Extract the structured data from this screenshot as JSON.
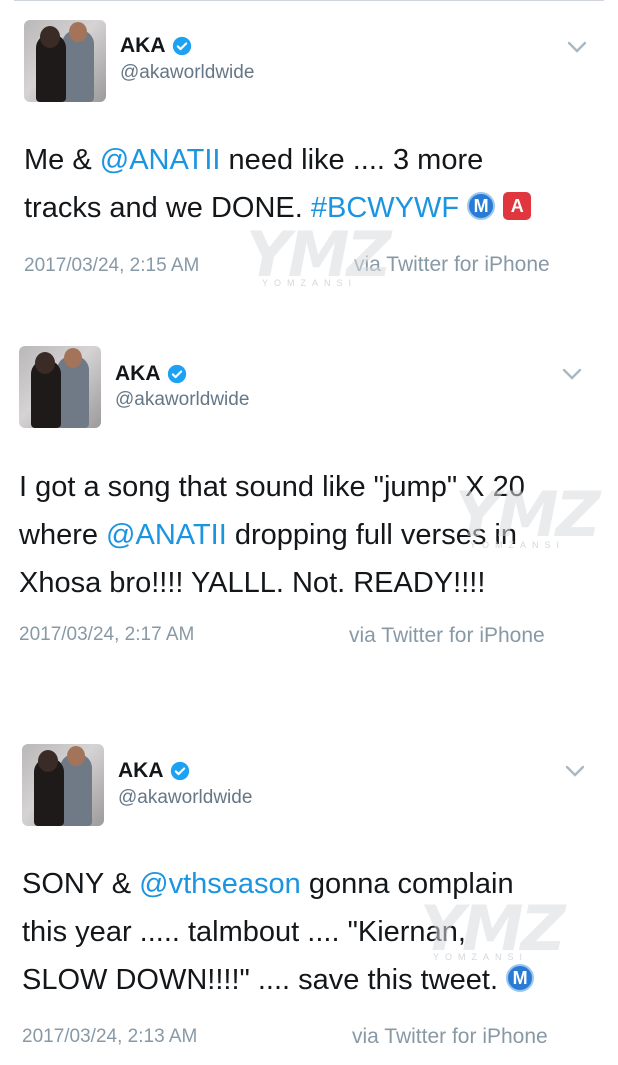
{
  "tweets": [
    {
      "name": "AKA",
      "handle": "@akaworldwide",
      "lines": [
        [
          {
            "t": "Me & "
          },
          {
            "t": "@ANATII",
            "link": true
          },
          {
            "t": " need like .... 3 more"
          }
        ],
        [
          {
            "t": "tracks and we DONE. "
          },
          {
            "t": "#BCWYWF",
            "link": true
          },
          {
            "t": " "
          },
          {
            "e": "M"
          },
          {
            "t": " "
          },
          {
            "e": "A"
          }
        ]
      ],
      "timestamp": "2017/03/24, 2:15 AM",
      "source": "via Twitter for iPhone"
    },
    {
      "name": "AKA",
      "handle": "@akaworldwide",
      "lines": [
        [
          {
            "t": "I got a song that sound like \"jump\" X 20"
          }
        ],
        [
          {
            "t": "where "
          },
          {
            "t": "@ANATII",
            "link": true
          },
          {
            "t": " dropping full verses in"
          }
        ],
        [
          {
            "t": "Xhosa bro!!!! YALLL. Not. READY!!!!"
          }
        ]
      ],
      "timestamp": "2017/03/24, 2:17 AM",
      "source": "via Twitter for iPhone"
    },
    {
      "name": "AKA",
      "handle": "@akaworldwide",
      "lines": [
        [
          {
            "t": "SONY & "
          },
          {
            "t": "@vthseason",
            "link": true
          },
          {
            "t": " gonna complain"
          }
        ],
        [
          {
            "t": "this year ..... talmbout .... \"Kiernan,"
          }
        ],
        [
          {
            "t": "SLOW DOWN!!!!\" .... save this tweet. "
          },
          {
            "e": "M"
          }
        ]
      ],
      "timestamp": "2017/03/24, 2:13 AM",
      "source": "via Twitter for iPhone"
    }
  ],
  "watermark": {
    "logo": "YMZ",
    "sub": "YOMZANSI"
  },
  "colors": {
    "link": "#1b95e0",
    "verified": "#1da1f2",
    "meta": "#8899a6",
    "handle": "#657786"
  },
  "icons": {
    "verified": "verified-badge-icon",
    "menu": "chevron-down-icon",
    "emoji_m": "circled-m-emoji",
    "emoji_a": "a-button-emoji"
  }
}
